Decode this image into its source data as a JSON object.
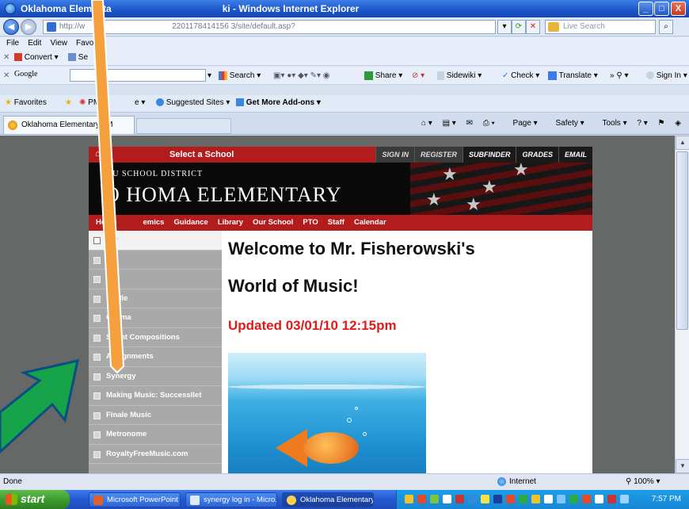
{
  "window": {
    "title": "Oklahoma Elementary | Mr. Fisherowski - Windows Internet Explorer",
    "title_visible_left": "Oklahoma Elementa",
    "title_visible_right": "ki - Windows Internet Explorer",
    "min_label": "_",
    "max_label": "□",
    "close_label": "X"
  },
  "address": {
    "back_label": "◀",
    "forward_label": "▶",
    "url_left": "http://w",
    "url_right": "2201178414156 3/site/default.asp?",
    "live_search_placeholder": "Live Search"
  },
  "menu": {
    "items": [
      "File",
      "Edit",
      "View",
      "Favori"
    ]
  },
  "toolbars": {
    "convert_label": "Convert",
    "select_label": "Se",
    "google_label": "Google",
    "search_label": "Search",
    "share_label": "Share",
    "sidewiki_label": "Sidewiki",
    "check_label": "Check",
    "translate_label": "Translate",
    "signin_label": "Sign In"
  },
  "favorites": {
    "favorites_label": "Favorites",
    "pm_label": "PM",
    "item2_label": "e",
    "suggested_label": "Suggested Sites",
    "addons_label": "Get More Add-ons"
  },
  "tabs": {
    "active_label": "Oklahoma Elementary | M",
    "commands": [
      "Page",
      "Safety",
      "Tools"
    ]
  },
  "site": {
    "topbar": {
      "home_icon": "⌂",
      "brand_small": "D",
      "select_school": "Select a School",
      "links": [
        "SIGN IN",
        "REGISTER",
        "SUBFINDER",
        "GRADES",
        "EMAIL"
      ]
    },
    "banner": {
      "district": "DU          SCHOOL DISTRICT",
      "school": "O     HOMA ELEMENTARY"
    },
    "nav": [
      "Home",
      "emics",
      "Guidance",
      "Library",
      "Our School",
      "PTO",
      "Staff",
      "Calendar"
    ],
    "sidebar": [
      "We",
      "Ba",
      "Pe",
      "Syl        lle",
      "Okl        ma",
      "Stu      nt Compositions",
      "Ass   gnments",
      "Synergy",
      "Making Music: Successllet",
      "Finale Music",
      "Metronome",
      "RoyaltyFreeMusic.com"
    ],
    "heading_line1": "Welcome to Mr. Fisherowski's",
    "heading_line2": "World of Music!",
    "updated": "Updated 03/01/10  12:15pm"
  },
  "status": {
    "left": "Done",
    "zone": "Internet",
    "zoom": "100%"
  },
  "taskbar": {
    "start_label": "start",
    "tasks": [
      "Microsoft PowerPoint ...",
      "synergy log in - Micro...",
      "Oklahoma Elementary..."
    ],
    "clock": "7:57 PM"
  },
  "colors": {
    "site_red": "#b31c1c",
    "sidebar_gray": "#a9a9a9",
    "updated_red": "#e21a1a",
    "annotation_orange": "#f5a03c",
    "annotation_green": "#16a34a"
  }
}
